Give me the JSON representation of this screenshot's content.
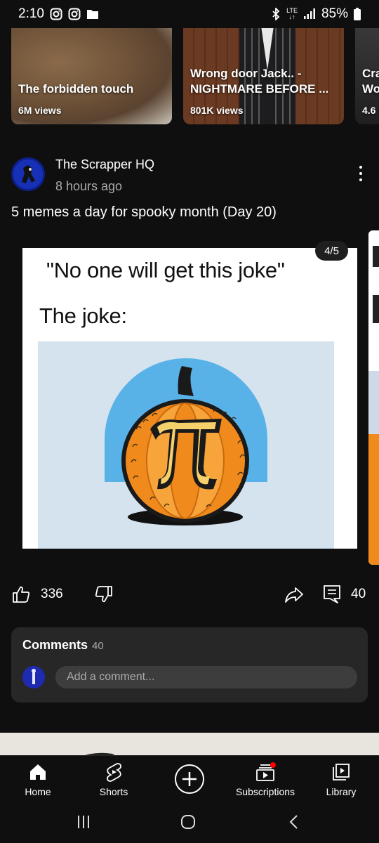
{
  "status_bar": {
    "time": "2:10",
    "network": "LTE",
    "battery": "85%",
    "icons": [
      "instagram-icon",
      "instagram-icon",
      "folder-icon",
      "bluetooth-icon",
      "signal-icon",
      "battery-icon"
    ]
  },
  "shelf": {
    "videos": [
      {
        "title": "The forbidden touch",
        "views": "6M views"
      },
      {
        "title_line1": "Wrong door Jack.. -",
        "title_line2": "NIGHTMARE BEFORE ...",
        "views": "801K views"
      },
      {
        "title_line1": "Cra",
        "title_line2": "Wo",
        "views": "4.6"
      }
    ]
  },
  "post": {
    "channel": "The Scrapper HQ",
    "time_ago": "8 hours ago",
    "text": "5 memes a day for spooky month (Day 20)",
    "image": {
      "counter": "4/5",
      "line1": "\"No one will get this joke\"",
      "line2": "The joke:"
    },
    "likes": "336",
    "comment_count": "40"
  },
  "comments": {
    "title": "Comments",
    "count": "40",
    "placeholder": "Add a comment..."
  },
  "bottom_nav": {
    "items": [
      {
        "label": "Home",
        "icon": "home-icon"
      },
      {
        "label": "Shorts",
        "icon": "shorts-icon"
      },
      {
        "label": "",
        "icon": "create-icon"
      },
      {
        "label": "Subscriptions",
        "icon": "subscriptions-icon"
      },
      {
        "label": "Library",
        "icon": "library-icon"
      }
    ]
  },
  "colors": {
    "background": "#0f0f0f",
    "card": "#272727",
    "notification_dot": "#ff0000",
    "text_secondary": "#aaaaaa"
  }
}
